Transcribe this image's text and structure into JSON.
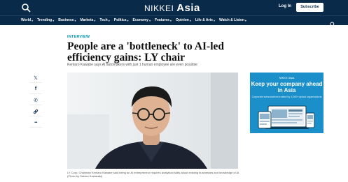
{
  "header": {
    "logo_brand": "NIKKEI",
    "logo_region": "Asia",
    "login_label": "Log In",
    "subscribe_label": "Subscribe"
  },
  "nav": {
    "items": [
      {
        "label": "World"
      },
      {
        "label": "Trending"
      },
      {
        "label": "Business"
      },
      {
        "label": "Markets"
      },
      {
        "label": "Tech"
      },
      {
        "label": "Politics"
      },
      {
        "label": "Economy"
      },
      {
        "label": "Features"
      },
      {
        "label": "Opinion"
      },
      {
        "label": "Life & Arts"
      },
      {
        "label": "Watch & Listen"
      }
    ]
  },
  "article": {
    "section": "INTERVIEW",
    "headline": "People are a 'bottleneck' to AI-led efficiency gains: LY chair",
    "subhead": "Kentaro Kawabe says AI automakers with just 1 human employee are even possible",
    "caption": "LY Corp. Chairman Kentaro Kawabe said being an AI entrepreneur requires analytical skills about existing businesses and knowledge of AI. (Photo by Satoko Kawasaki)"
  },
  "share": {
    "buttons": [
      {
        "icon": "x-icon",
        "glyph": "𝕏"
      },
      {
        "icon": "facebook-icon",
        "glyph": "f"
      },
      {
        "icon": "whatsapp-icon",
        "glyph": "✆"
      },
      {
        "icon": "link-icon",
        "glyph": "🔗"
      },
      {
        "icon": "more-icon",
        "glyph": "•••"
      }
    ]
  },
  "ad": {
    "brand": "NIKKEI Asia",
    "title": "Keep your company ahead in Asia",
    "subtitle": "Corporate subscriptions trusted by 1,000+ global organisations"
  },
  "colors": {
    "header_bg": "#0a2a4a",
    "accent": "#0097b2",
    "ad_bg": "#1b8fc9"
  }
}
